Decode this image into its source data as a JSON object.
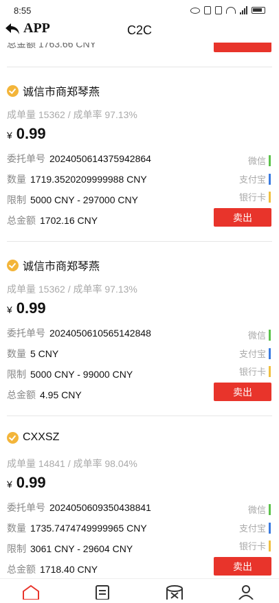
{
  "status": {
    "time": "8:55",
    "network": "5G"
  },
  "header": {
    "back_label": "APP",
    "title": "C2C"
  },
  "peek": {
    "text": "总金额 1763.66 CNY"
  },
  "colors": {
    "sell": "#e8342b",
    "wechat": "#5cc24a",
    "alipay": "#3b7be0",
    "bank": "#f0c040",
    "medal": "#f3b53a"
  },
  "labels": {
    "order_no": "委托单号",
    "qty": "数量",
    "limit": "限制",
    "total": "总金额",
    "sell": "卖出",
    "pay_wechat": "微信",
    "pay_alipay": "支付宝",
    "pay_bank": "银行卡",
    "currency_symbol": "¥"
  },
  "listings": [
    {
      "merchant": "诚信市商郑琴燕",
      "stats": "成单量 15362 / 成单率 97.13%",
      "price": "0.99",
      "order_no": "2024050614375942864",
      "qty": "1719.3520209999988 CNY",
      "limit": "5000 CNY - 297000 CNY",
      "total": "1702.16 CNY"
    },
    {
      "merchant": "诚信市商郑琴燕",
      "stats": "成单量 15362 / 成单率 97.13%",
      "price": "0.99",
      "order_no": "2024050610565142848",
      "qty": "5 CNY",
      "limit": "5000 CNY - 99000 CNY",
      "total": "4.95 CNY"
    },
    {
      "merchant": "CXXSZ",
      "stats": "成单量 14841 / 成单率 98.04%",
      "price": "0.99",
      "order_no": "2024050609350438841",
      "qty": "1735.7474749999965 CNY",
      "limit": "3061 CNY - 29604 CNY",
      "total": "1718.40 CNY"
    }
  ],
  "tabbar": {
    "icons": [
      "home-icon",
      "orders-icon",
      "trade-icon",
      "profile-icon"
    ]
  }
}
